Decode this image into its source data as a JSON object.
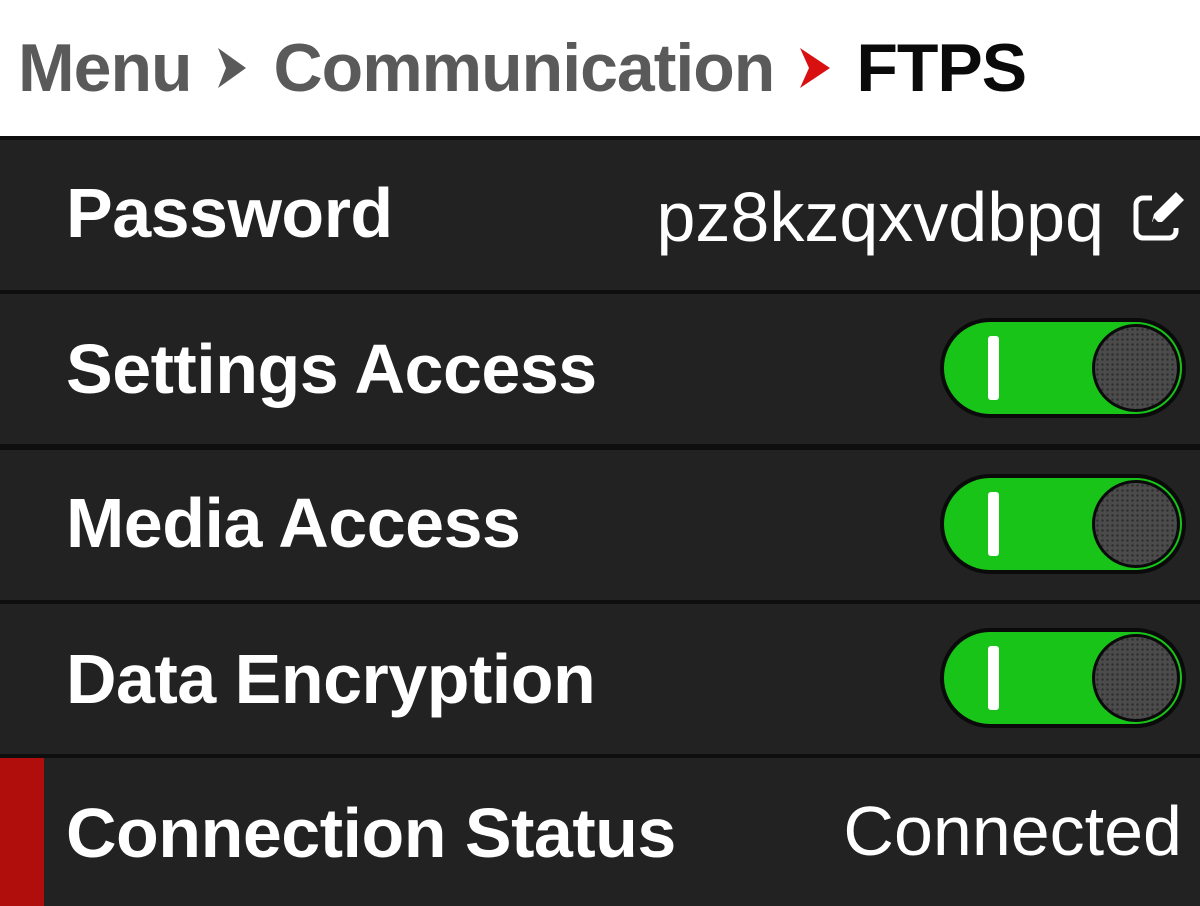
{
  "breadcrumb": {
    "items": [
      "Menu",
      "Communication"
    ],
    "current": "FTPS",
    "separator_color": "#5a5a5a",
    "active_separator_color": "#d81010"
  },
  "settings": {
    "password": {
      "label": "Password",
      "value": "pz8kzqxvdbpq",
      "icon": "edit-icon"
    },
    "settings_access": {
      "label": "Settings Access",
      "enabled": true
    },
    "media_access": {
      "label": "Media Access",
      "enabled": true
    },
    "data_encryption": {
      "label": "Data Encryption",
      "enabled": true
    },
    "connection_status": {
      "label": "Connection Status",
      "value": "Connected"
    }
  },
  "colors": {
    "toggle_on": "#19c419",
    "accent": "#b00d0d",
    "row_bg": "#222222"
  }
}
